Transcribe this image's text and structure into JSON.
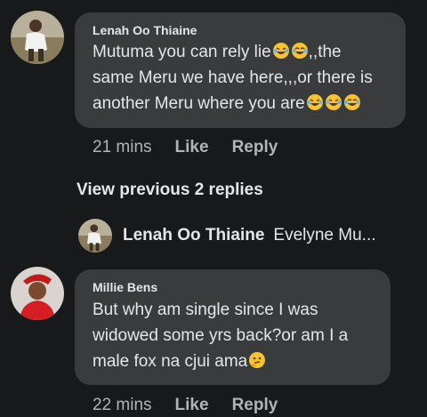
{
  "comments": [
    {
      "author": "Lenah Oo Thiaine",
      "lines": [
        {
          "text": "Mutuma you can rely lie",
          "emojis_after": [
            "rolling-laughing-emoji",
            "laughing-tears-emoji"
          ],
          "tail": ",,the"
        },
        {
          "text": "same Meru we have here,,,or there is"
        },
        {
          "text": "another Meru where you are",
          "emojis_after": [
            "rolling-laughing-emoji",
            "rolling-laughing-emoji",
            "laughing-tears-emoji"
          ]
        }
      ],
      "time": "21 mins",
      "like_label": "Like",
      "reply_label": "Reply"
    },
    {
      "author": "Millie Bens",
      "lines": [
        {
          "text": "But why am single since I was"
        },
        {
          "text": "widowed some yrs back?or am I a"
        },
        {
          "text": "male fox na cjui ama",
          "emojis_after": [
            "thinking-face-emoji"
          ]
        }
      ],
      "time": "22 mins",
      "like_label": "Like",
      "reply_label": "Reply"
    }
  ],
  "view_previous_label": "View previous 2 replies",
  "reply_preview": {
    "author": "Lenah Oo Thiaine",
    "snippet": "Evelyne Mu..."
  },
  "colors": {
    "background": "#18191a",
    "bubble": "#3a3b3c",
    "text": "#e4e6eb",
    "muted": "#b0b3b8"
  }
}
